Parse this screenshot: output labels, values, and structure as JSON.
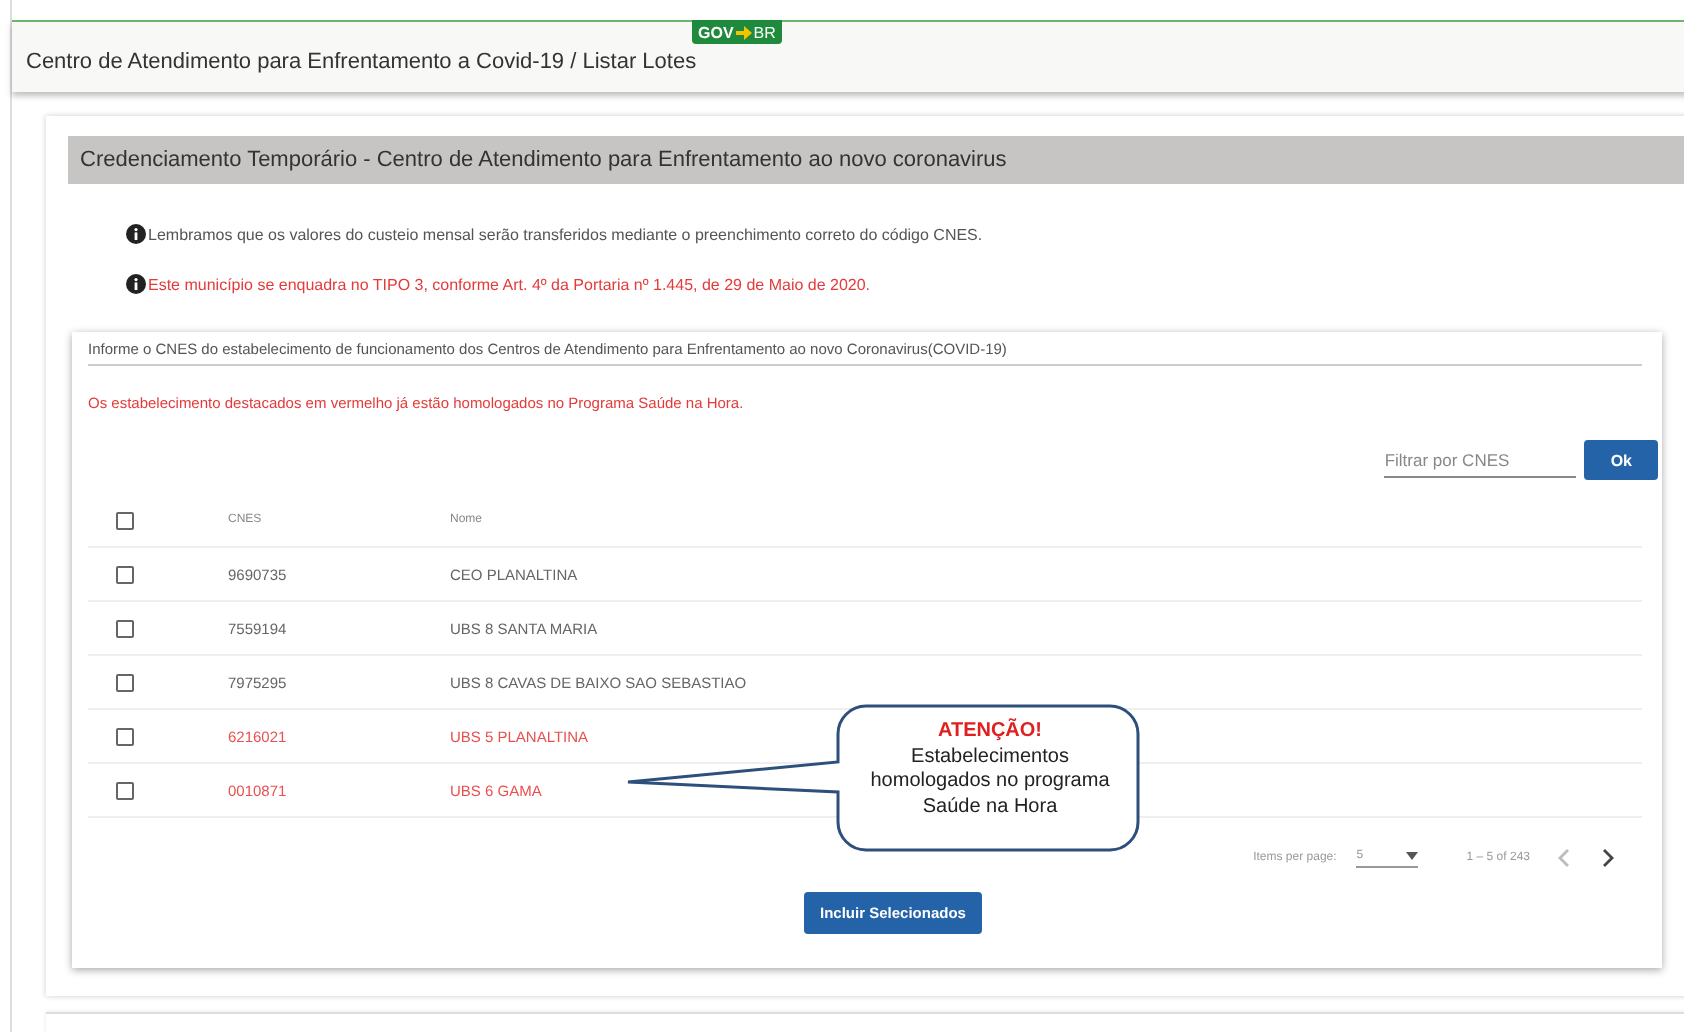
{
  "header": {
    "title": "Centro de Atendimento para Enfrentamento a Covid-19 / Listar Lotes",
    "badge": {
      "left": "GOV",
      "right": "BR"
    }
  },
  "section": {
    "title": "Credenciamento Temporário - Centro de Atendimento para Enfrentamento ao novo coronavirus"
  },
  "notes": [
    {
      "text": "Lembramos que os valores do custeio mensal serão transferidos mediante o preenchimento correto do código CNES.",
      "alert": false
    },
    {
      "text": "Este município se enquadra no TIPO 3, conforme Art. 4º da Portaria nº 1.445, de 29 de Maio de 2020.",
      "alert": true
    }
  ],
  "card": {
    "label": "Informe o CNES do estabelecimento de funcionamento dos Centros de Atendimento para Enfrentamento ao novo Coronavirus(COVID-19)",
    "warning": "Os estabelecimento destacados em vermelho já estão homologados no Programa Saúde na Hora.",
    "filter": {
      "placeholder": "Filtrar por CNES",
      "button": "Ok"
    },
    "table": {
      "select_all_checked": false,
      "columns": [
        "CNES",
        "Nome"
      ],
      "rows": [
        {
          "checked": false,
          "highlighted": false,
          "cnes": "9690735",
          "nome": "CEO PLANALTINA"
        },
        {
          "checked": false,
          "highlighted": false,
          "cnes": "7559194",
          "nome": "UBS 8 SANTA MARIA"
        },
        {
          "checked": false,
          "highlighted": false,
          "cnes": "7975295",
          "nome": "UBS 8 CAVAS DE BAIXO SAO SEBASTIAO"
        },
        {
          "checked": false,
          "highlighted": true,
          "cnes": "6216021",
          "nome": "UBS 5 PLANALTINA"
        },
        {
          "checked": false,
          "highlighted": true,
          "cnes": "0010871",
          "nome": "UBS 6 GAMA"
        }
      ]
    },
    "paginator": {
      "label": "Items per page:",
      "page_size": "5",
      "range": "1 – 5 of 243",
      "prev_disabled": true,
      "next_disabled": false
    },
    "submit": "Incluir Selecionados"
  },
  "callout": {
    "title": "ATENÇÃO!",
    "lines": [
      "Estabelecimentos",
      "homologados no programa",
      "Saúde na Hora"
    ]
  }
}
